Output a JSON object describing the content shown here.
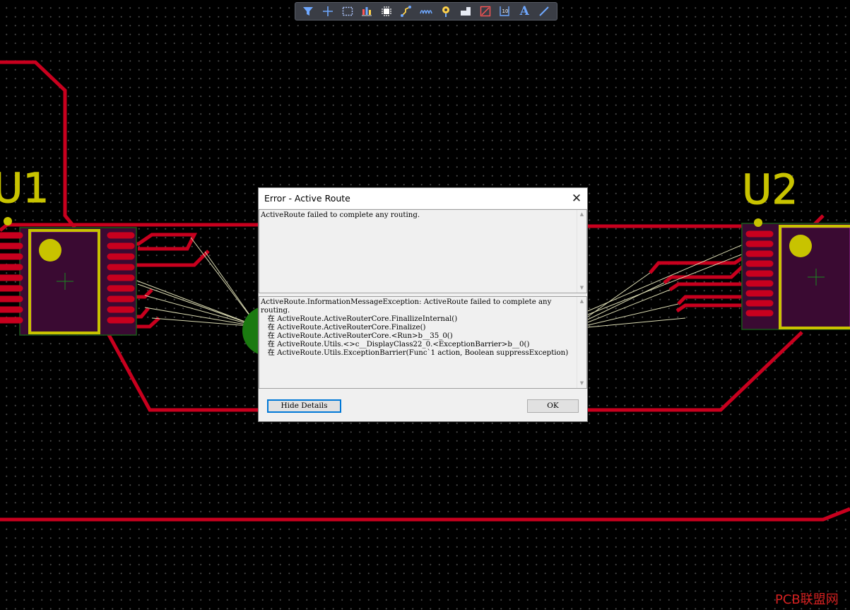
{
  "toolbar": {
    "items": [
      {
        "icon": "filter-icon"
      },
      {
        "icon": "crosshair-plus-icon"
      },
      {
        "icon": "selection-rectangle-icon"
      },
      {
        "icon": "align-chart-icon"
      },
      {
        "icon": "component-chip-icon"
      },
      {
        "icon": "route-track-icon"
      },
      {
        "icon": "interactive-diff-pair-icon"
      },
      {
        "icon": "via-icon"
      },
      {
        "icon": "polygon-fill-icon"
      },
      {
        "icon": "keepout-region-icon"
      },
      {
        "icon": "dimension-icon"
      },
      {
        "icon": "text-A-icon",
        "label": "A"
      },
      {
        "icon": "line-icon"
      }
    ]
  },
  "board": {
    "designators": [
      "U1",
      "U2"
    ],
    "colors": {
      "track": "#c8001e",
      "silkscreen": "#c8c300",
      "pad": "#c8001e",
      "pad_hatch": "#cc33cc",
      "ratsnest": "#d8d8b0",
      "via": "#1a7a10",
      "grid_dot": "#4a4a4a"
    }
  },
  "dialog": {
    "title": "Error - Active Route",
    "close_symbol": "✕",
    "message": "ActiveRoute failed to complete any routing.",
    "details": "ActiveRoute.InformationMessageException: ActiveRoute failed to complete any routing.\n   在 ActiveRoute.ActiveRouterCore.FinallizeInternal()\n   在 ActiveRoute.ActiveRouterCore.Finalize()\n   在 ActiveRoute.ActiveRouterCore.<Run>b__35_0()\n   在 ActiveRoute.Utils.<>c__DisplayClass22_0.<ExceptionBarrier>b__0()\n   在 ActiveRoute.Utils.ExceptionBarrier(Func`1 action, Boolean suppressException)",
    "hide_details_label": "Hide Details",
    "ok_label": "OK"
  },
  "watermark": "PCB联盟网"
}
